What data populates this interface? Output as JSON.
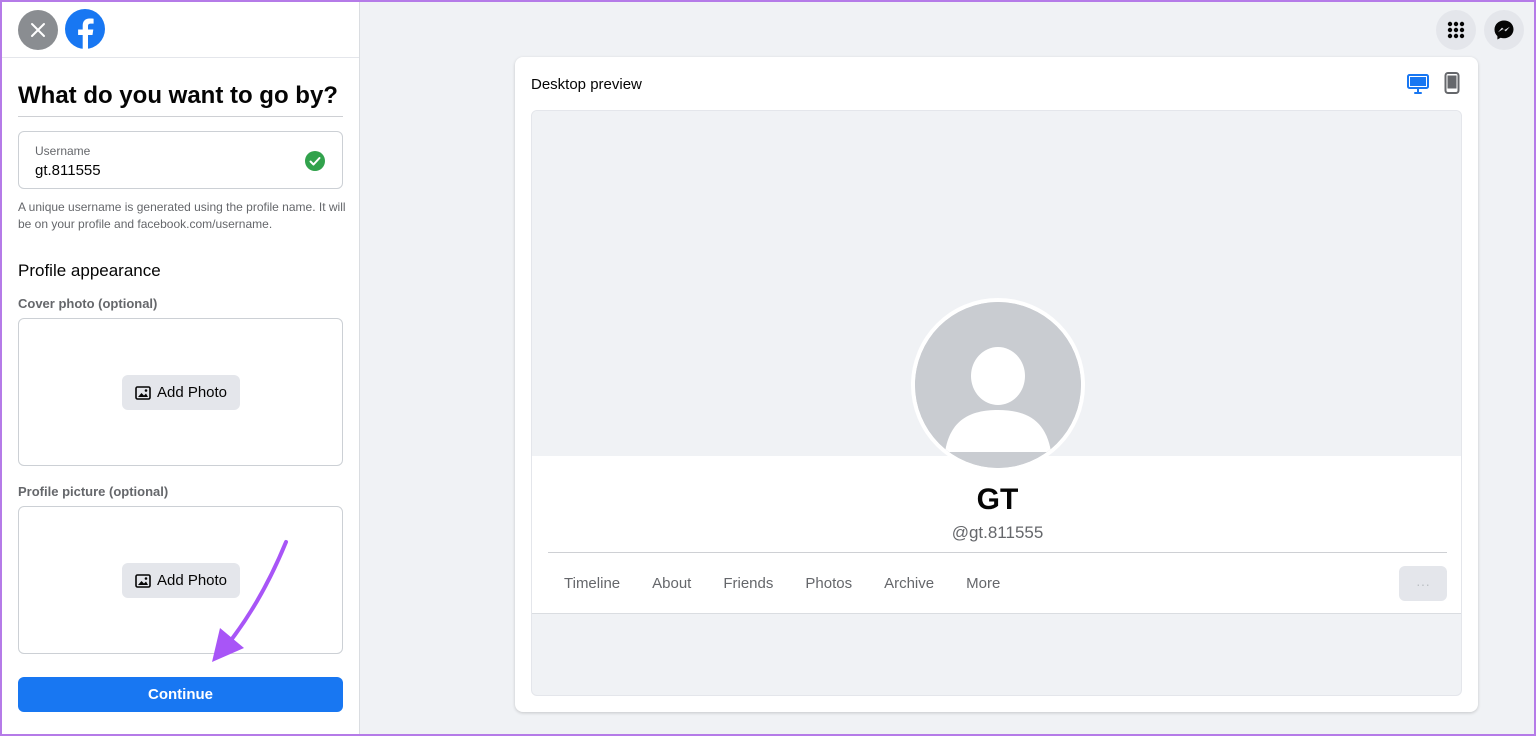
{
  "heading": "What do you want to go by?",
  "username_field": {
    "label": "Username",
    "value": "gt.811555"
  },
  "hint_text": "A unique username is generated using the profile name. It will be on your profile and facebook.com/username.",
  "profile_appearance": {
    "title": "Profile appearance",
    "cover_label": "Cover photo (optional)",
    "profile_label": "Profile picture (optional)",
    "add_photo_label": "Add Photo"
  },
  "continue_label": "Continue",
  "preview": {
    "title": "Desktop preview",
    "name": "GT",
    "username": "@gt.811555",
    "nav": [
      "Timeline",
      "About",
      "Friends",
      "Photos",
      "Archive",
      "More"
    ],
    "more_button": "···"
  },
  "colors": {
    "brand_blue": "#1877f2",
    "success_green": "#31a24c",
    "arrow_purple": "#a855f7"
  },
  "icons": {
    "close": "close-icon",
    "logo": "facebook-logo-icon",
    "valid": "check-circle-icon",
    "photo": "photo-icon",
    "menu": "apps-grid-icon",
    "messenger": "messenger-icon",
    "desktop": "desktop-icon",
    "mobile": "mobile-icon"
  }
}
